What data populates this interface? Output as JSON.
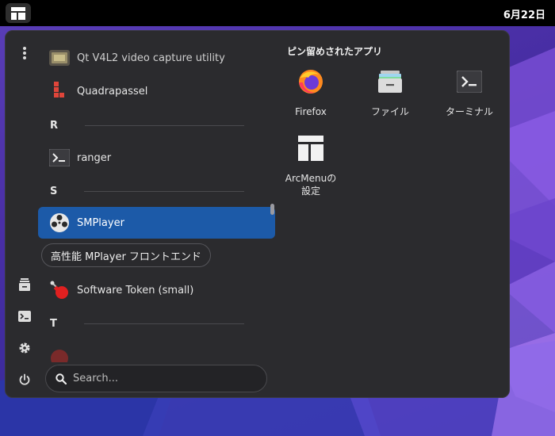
{
  "topbar": {
    "clock": "6月22日"
  },
  "app_list": {
    "items": [
      {
        "label": "Qt V4L2 video capture utility",
        "icon": "webcam-icon"
      },
      {
        "label": "Quadrapassel",
        "icon": "quadrapassel-icon"
      },
      {
        "section": "R"
      },
      {
        "label": "ranger",
        "icon": "terminal-icon"
      },
      {
        "section": "S"
      },
      {
        "label": "SMPlayer",
        "icon": "smplayer-icon",
        "selected": true
      },
      {
        "label": "Software Token (small)",
        "icon": "token-icon"
      },
      {
        "section": "T"
      }
    ],
    "tooltip": "高性能 MPlayer フロントエンド"
  },
  "search": {
    "placeholder": "Search..."
  },
  "pinned": {
    "title": "ピン留めされたアプリ",
    "apps": [
      {
        "label": "Firefox",
        "icon": "firefox-icon"
      },
      {
        "label": "ファイル",
        "icon": "files-icon"
      },
      {
        "label": "ターミナル",
        "icon": "terminal-icon"
      },
      {
        "label_line1": "ArcMenuの",
        "label_line2": "設定",
        "icon": "arcmenu-icon"
      }
    ]
  },
  "colors": {
    "accent": "#1c5aa8",
    "panel": "#2b2b2e",
    "topbar": "#000000"
  }
}
